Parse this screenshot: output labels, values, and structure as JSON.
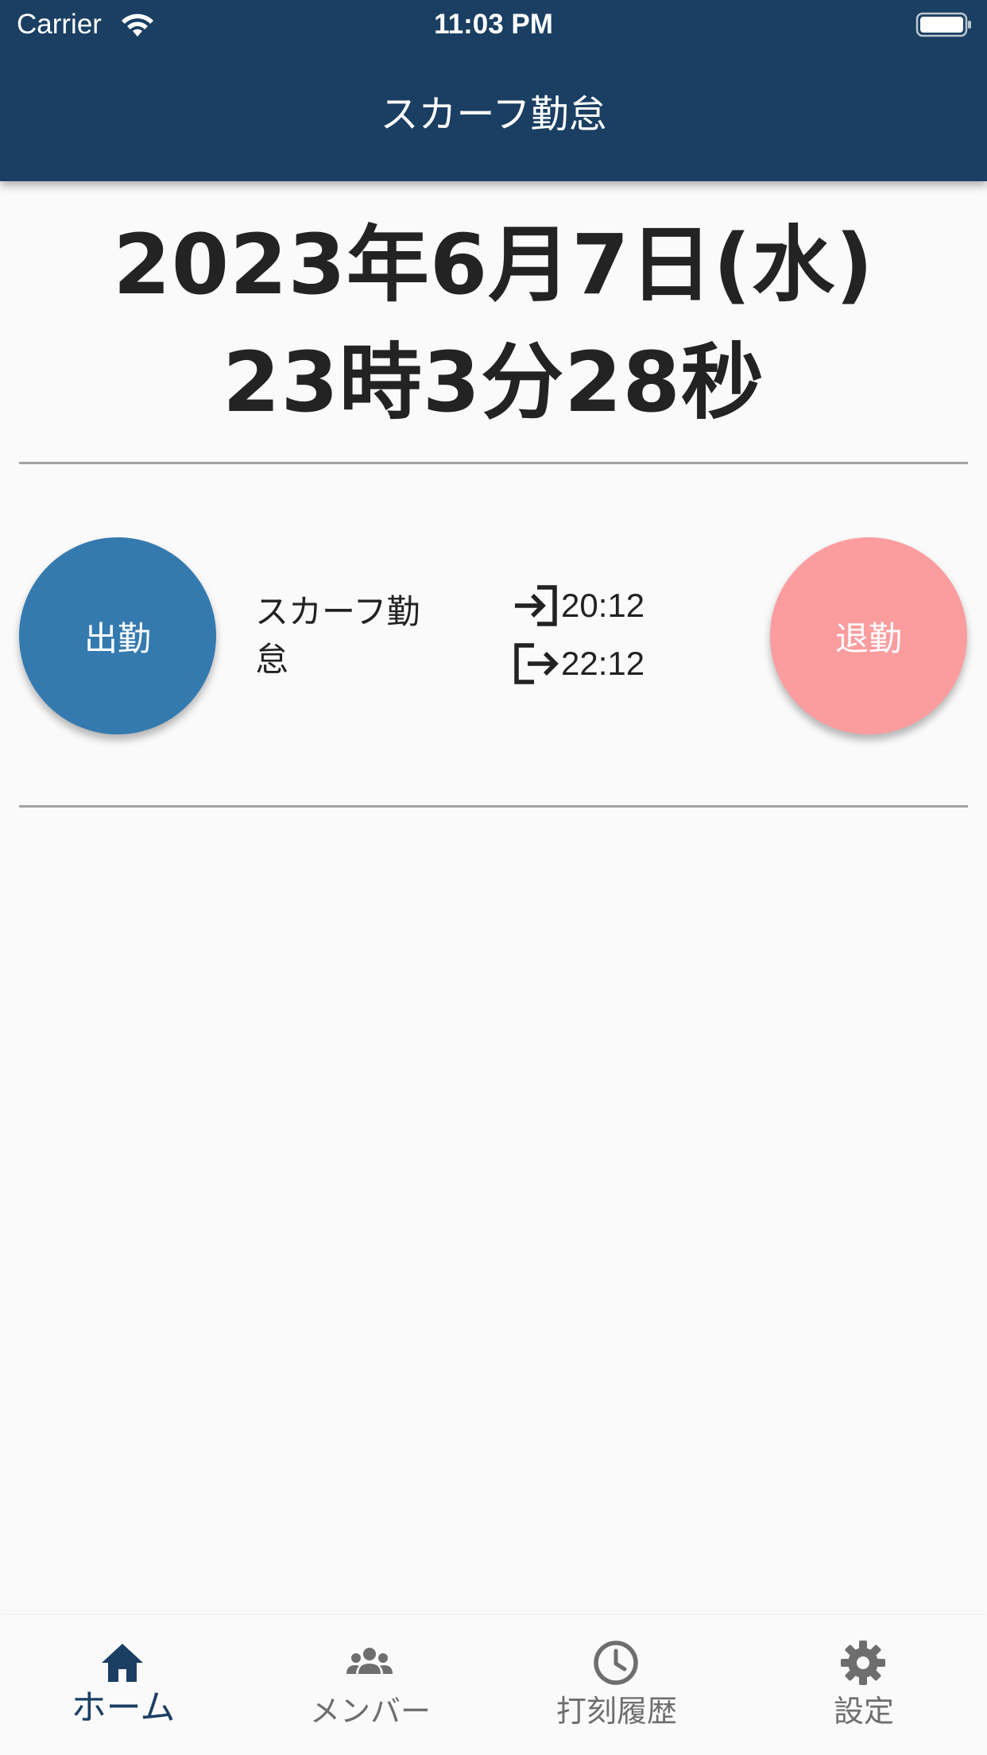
{
  "status_bar": {
    "carrier": "Carrier",
    "time": "11:03 PM"
  },
  "app_bar": {
    "title": "スカーフ勤怠"
  },
  "now": {
    "date": "2023年6月7日(水)",
    "time": "23時3分28秒"
  },
  "attendance": {
    "clock_in_label": "出勤",
    "clock_out_label": "退勤",
    "member_name": "スカーフ勤怠",
    "clock_in_time": "20:12",
    "clock_out_time": "22:12"
  },
  "bottom_nav": {
    "items": [
      {
        "label": "ホーム",
        "icon": "home-icon",
        "active": true
      },
      {
        "label": "メンバー",
        "icon": "people-icon",
        "active": false
      },
      {
        "label": "打刻履歴",
        "icon": "clock-history-icon",
        "active": false
      },
      {
        "label": "設定",
        "icon": "gear-icon",
        "active": false
      }
    ]
  },
  "colors": {
    "primary": "#1b3f62",
    "clock_in": "#357aaf",
    "clock_out": "#fb9d9f",
    "inactive": "#6e6e6e"
  }
}
